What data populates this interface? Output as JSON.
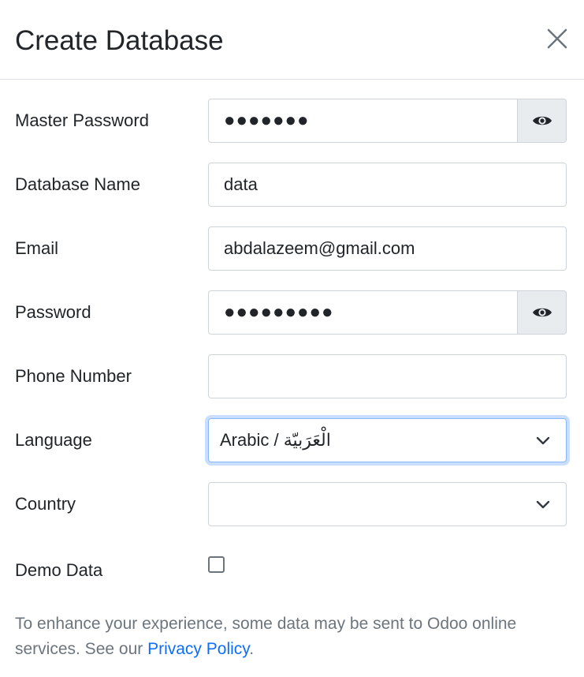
{
  "modal": {
    "title": "Create Database",
    "close_icon": "close-icon"
  },
  "form": {
    "master_password": {
      "label": "Master Password",
      "value": "●●●●●●●",
      "toggle_icon": "eye-icon"
    },
    "database_name": {
      "label": "Database Name",
      "value": "data"
    },
    "email": {
      "label": "Email",
      "value": "abdalazeem@gmail.com"
    },
    "password": {
      "label": "Password",
      "value": "●●●●●●●●●",
      "toggle_icon": "eye-icon"
    },
    "phone_number": {
      "label": "Phone Number",
      "value": ""
    },
    "language": {
      "label": "Language",
      "selected": "Arabic / الْعَرَبيّة",
      "icon": "chevron-down-icon"
    },
    "country": {
      "label": "Country",
      "selected": "",
      "icon": "chevron-down-icon"
    },
    "demo_data": {
      "label": "Demo Data",
      "checked": false
    }
  },
  "footer": {
    "text": "To enhance your experience, some data may be sent to Odoo online services. See our ",
    "link": "Privacy Policy",
    "suffix": "."
  },
  "colors": {
    "link": "#0d6efd",
    "muted": "#6c757d",
    "border": "#ced4da",
    "addon_bg": "#e9ecef",
    "focus": "#86b7fe"
  }
}
